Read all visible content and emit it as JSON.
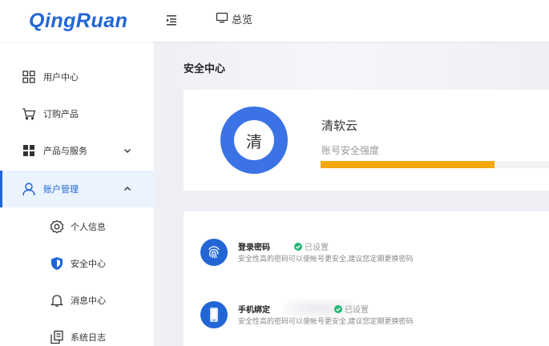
{
  "header": {
    "logo": "QingRuan",
    "overview_label": "总览"
  },
  "sidebar": {
    "items": [
      {
        "label": "用户中心",
        "icon": "grid-icon"
      },
      {
        "label": "订购产品",
        "icon": "cart-icon"
      },
      {
        "label": "产品与服务",
        "icon": "apps-icon",
        "chevron": "down"
      },
      {
        "label": "账户管理",
        "icon": "user-icon",
        "chevron": "up",
        "active": true
      },
      {
        "label": "个人信息",
        "icon": "gear-icon"
      },
      {
        "label": "安全中心",
        "icon": "shield-icon"
      },
      {
        "label": "消息中心",
        "icon": "bell-icon"
      },
      {
        "label": "系统日志",
        "icon": "log-icon"
      }
    ]
  },
  "main": {
    "page_title": "安全中心",
    "profile": {
      "avatar_char": "清",
      "name": "清软云",
      "security_label": "账号安全强度",
      "security_strength": 0.76
    },
    "security_items": [
      {
        "title": "登录密码",
        "status": "已设置",
        "description": "安全性高的密码可以使帐号更安全,建议您定期更换密码",
        "icon": "fingerprint-icon"
      },
      {
        "title": "手机绑定",
        "status": "已设置",
        "description": "安全性高的密码可以使帐号更安全,建议您定期更换密码",
        "icon": "phone-icon"
      }
    ]
  },
  "colors": {
    "primary": "#2266d6",
    "ring": "#3b73e6",
    "progress": "#f5a70f",
    "success": "#22b573"
  }
}
